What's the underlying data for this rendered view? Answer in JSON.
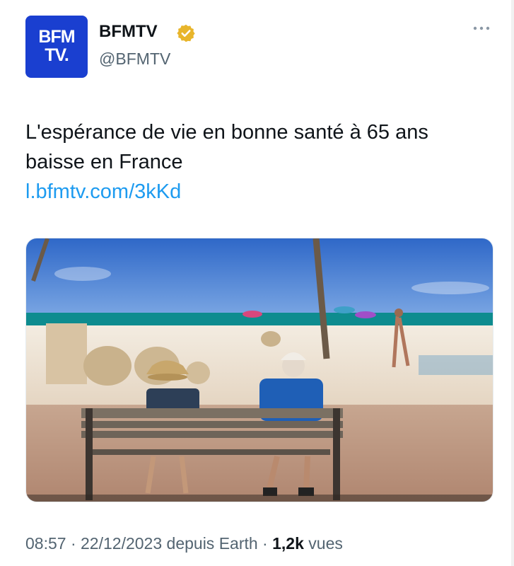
{
  "account": {
    "avatar_line1": "BFM",
    "avatar_line2": "TV.",
    "display_name": "BFMTV",
    "handle": "@BFMTV",
    "verified_color": "#e8b52b"
  },
  "tweet": {
    "text": "L'espérance de vie en bonne santé à 65 ans baisse en France",
    "link": "l.bfmtv.com/3kKd"
  },
  "meta": {
    "time": "08:57",
    "date": "22/12/2023",
    "source": "depuis Earth",
    "views_count": "1,2k",
    "views_label": "vues"
  },
  "icons": [
    "verified-badge-icon",
    "more-options-icon"
  ],
  "colors": {
    "link": "#1d9bf0",
    "brand": "#1a3fd0"
  }
}
